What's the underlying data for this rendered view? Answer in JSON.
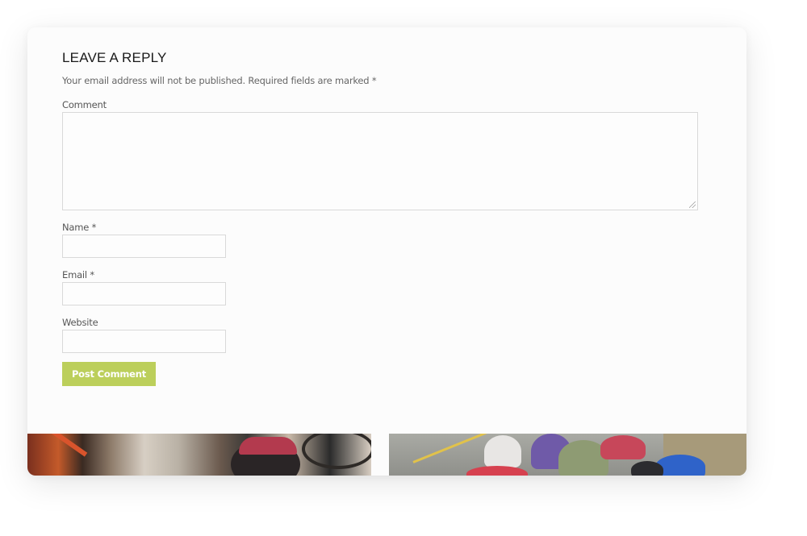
{
  "reply_form": {
    "title": "LEAVE A REPLY",
    "note": "Your email address will not be published. Required fields are marked *",
    "comment_label": "Comment",
    "comment_value": "",
    "name_label": "Name *",
    "name_value": "",
    "email_label": "Email *",
    "email_value": "",
    "website_label": "Website",
    "website_value": "",
    "submit_label": "Post Comment"
  },
  "colors": {
    "button": "#bccf5b",
    "card_background": "#fcfcfc",
    "field_border": "#d9d9d9"
  },
  "images": [
    {
      "name": "bike-shop-photo"
    },
    {
      "name": "cyclists-road-photo"
    }
  ]
}
